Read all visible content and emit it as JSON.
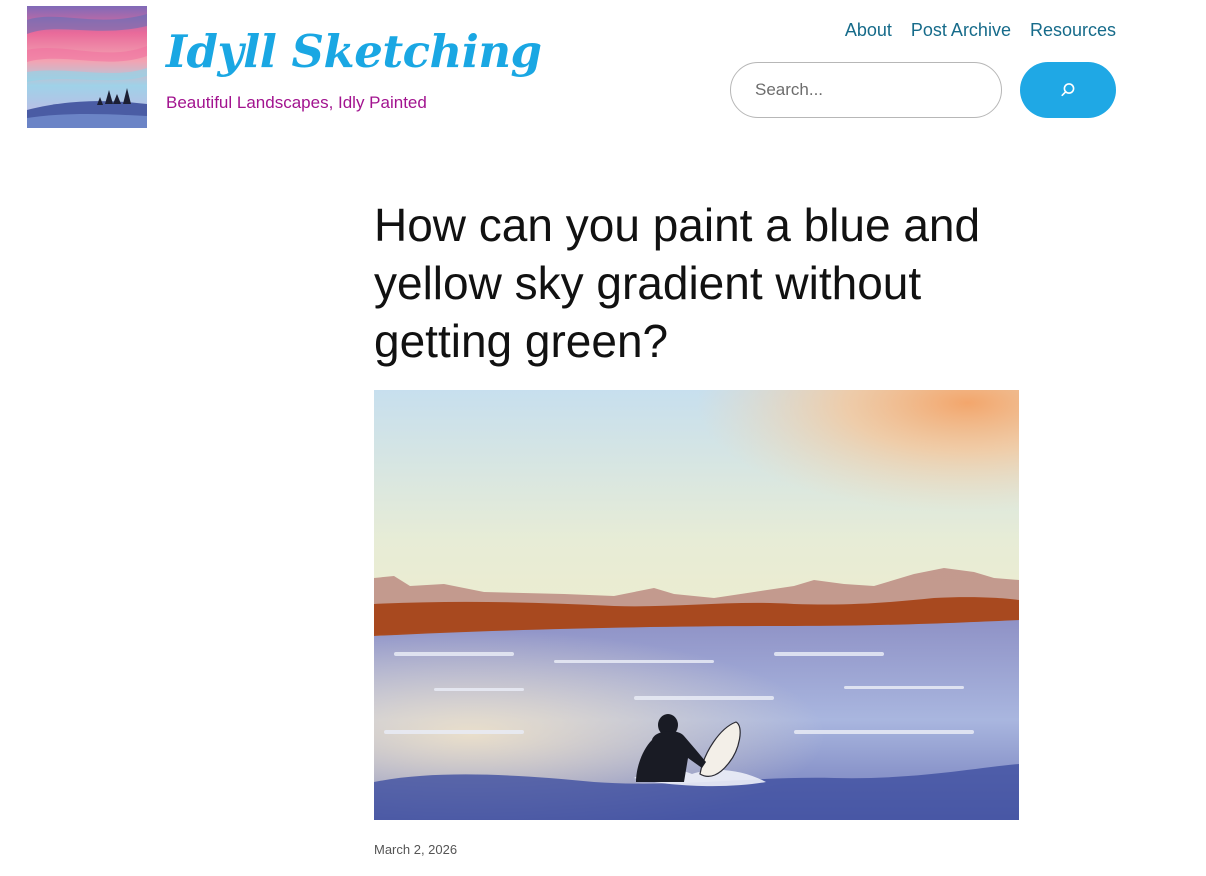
{
  "site": {
    "title": "Idyll Sketching",
    "tagline": "Beautiful Landscapes, Idly Painted",
    "logo_alt": "Idyll Sketching logo",
    "title_color": "#1aa7e3",
    "tagline_color": "#a2138f"
  },
  "nav": {
    "items": [
      {
        "label": "About"
      },
      {
        "label": "Post Archive"
      },
      {
        "label": "Resources"
      }
    ],
    "link_color": "#166b8a"
  },
  "search": {
    "placeholder": "Search...",
    "button_icon": "search-icon",
    "button_color": "#1fa8e5"
  },
  "post": {
    "title": "How can you paint a blue and yellow sky gradient without getting green?",
    "date": "March 2, 2026",
    "image_alt": "Watercolor of a surfer paddling at sunset under a blue and yellow sky"
  }
}
